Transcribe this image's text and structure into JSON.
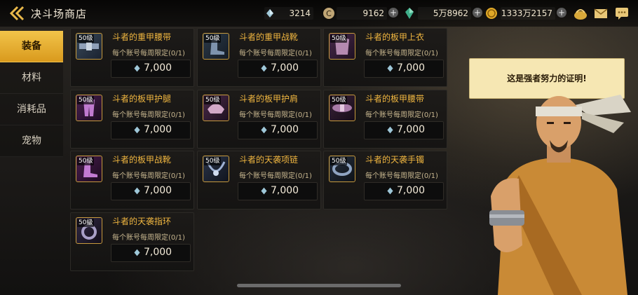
{
  "header": {
    "title": "决斗场商店",
    "currencies": [
      {
        "icon": "gem-shard-icon",
        "value": "3214",
        "has_plus": false
      },
      {
        "icon": "coin-c-icon",
        "value": "9162",
        "has_plus": true
      },
      {
        "icon": "green-crystal-icon",
        "value": "5万8962",
        "has_plus": true
      },
      {
        "icon": "gold-coin-icon",
        "value": "1333万2157",
        "has_plus": true
      }
    ]
  },
  "sidebar": {
    "tabs": [
      {
        "label": "装备",
        "active": true
      },
      {
        "label": "材料",
        "active": false
      },
      {
        "label": "消耗品",
        "active": false
      },
      {
        "label": "宠物",
        "active": false
      }
    ]
  },
  "items": [
    {
      "name": "斗者的重甲腰带",
      "level": "50级",
      "limit": "每个账号每周限定(0/1)",
      "price": "7,000"
    },
    {
      "name": "斗者的重甲战靴",
      "level": "50级",
      "limit": "每个账号每周限定(0/1)",
      "price": "7,000"
    },
    {
      "name": "斗者的板甲上衣",
      "level": "50级",
      "limit": "每个账号每周限定(0/1)",
      "price": "7,000"
    },
    {
      "name": "斗者的板甲护腿",
      "level": "50级",
      "limit": "每个账号每周限定(0/1)",
      "price": "7,000"
    },
    {
      "name": "斗者的板甲护肩",
      "level": "50级",
      "limit": "每个账号每周限定(0/1)",
      "price": "7,000"
    },
    {
      "name": "斗者的板甲腰带",
      "level": "50级",
      "limit": "每个账号每周限定(0/1)",
      "price": "7,000"
    },
    {
      "name": "斗者的板甲战靴",
      "level": "50级",
      "limit": "每个账号每周限定(0/1)",
      "price": "7,000"
    },
    {
      "name": "斗者的天袭项链",
      "level": "50级",
      "limit": "每个账号每周限定(0/1)",
      "price": "7,000"
    },
    {
      "name": "斗者的天袭手镯",
      "level": "50级",
      "limit": "每个账号每周限定(0/1)",
      "price": "7,000"
    },
    {
      "name": "斗者的天袭指环",
      "level": "50级",
      "limit": "每个账号每周限定(0/1)",
      "price": "7,000"
    }
  ],
  "npc": {
    "dialogue": "这是强者努力的证明!"
  },
  "colors": {
    "accent": "#f0b640",
    "active_tab": "#e8ae33",
    "speech_bg": "#f6e7b3"
  }
}
